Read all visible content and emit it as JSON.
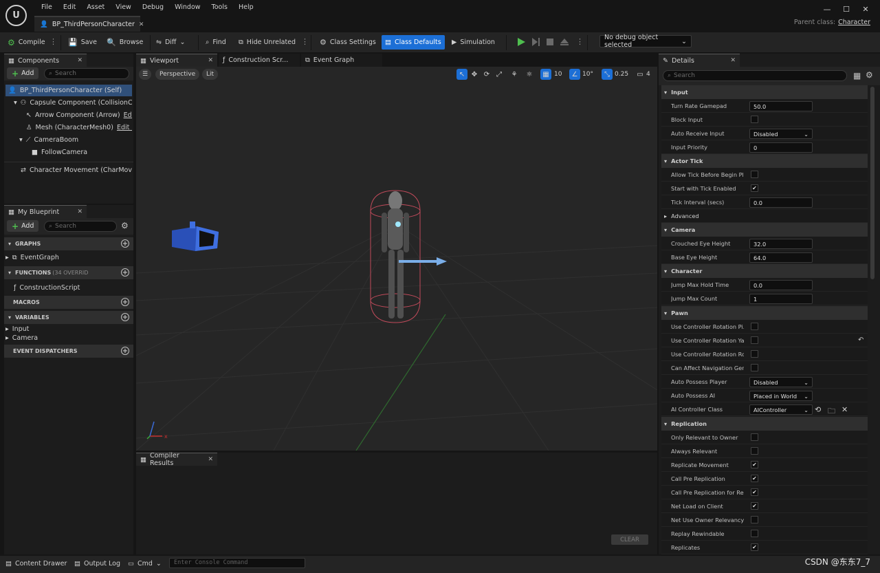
{
  "app": {
    "logo_text": "U"
  },
  "menu": [
    "File",
    "Edit",
    "Asset",
    "View",
    "Debug",
    "Window",
    "Tools",
    "Help"
  ],
  "document_tab": {
    "label": "BP_ThirdPersonCharacter"
  },
  "parent_class": {
    "label": "Parent class:",
    "value": "Character"
  },
  "toolbar": {
    "compile": "Compile",
    "save": "Save",
    "browse": "Browse",
    "diff": "Diff",
    "find": "Find",
    "hide_unrelated": "Hide Unrelated",
    "class_settings": "Class Settings",
    "class_defaults": "Class Defaults",
    "simulation": "Simulation",
    "debug_object": "No debug object selected"
  },
  "components": {
    "tab": "Components",
    "add": "Add",
    "search_placeholder": "Search",
    "items": [
      {
        "label": "BP_ThirdPersonCharacter (Self)",
        "link": ""
      },
      {
        "label": "Capsule Component (CollisionCylir",
        "link": ""
      },
      {
        "label": "Arrow Component (Arrow)",
        "link": "Edit i"
      },
      {
        "label": "Mesh (CharacterMesh0)",
        "link": "Edit in"
      },
      {
        "label": "CameraBoom",
        "link": ""
      },
      {
        "label": "FollowCamera",
        "link": ""
      },
      {
        "label": "Character Movement (CharMoveC",
        "link": ""
      }
    ]
  },
  "my_blueprint": {
    "tab": "My Blueprint",
    "add": "Add",
    "search_placeholder": "Search",
    "graphs": "GRAPHS",
    "event_graph": "EventGraph",
    "functions": "FUNCTIONS",
    "functions_note": "(34 OVERRID",
    "construction_script": "ConstructionScript",
    "macros": "MACROS",
    "variables": "VARIABLES",
    "var_input": "Input",
    "var_camera": "Camera",
    "event_dispatchers": "EVENT DISPATCHERS"
  },
  "editor_tabs": {
    "viewport": "Viewport",
    "construction": "Construction Scr...",
    "event_graph": "Event Graph"
  },
  "viewport": {
    "perspective": "Perspective",
    "lit": "Lit",
    "grid_snap": "10",
    "rot_snap": "10°",
    "scale_snap": "0.25",
    "cam_speed": "4",
    "axis_x": "x"
  },
  "compiler": {
    "tab": "Compiler Results",
    "clear": "CLEAR"
  },
  "details": {
    "tab": "Details",
    "search_placeholder": "Search",
    "sections": {
      "input": "Input",
      "actor_tick": "Actor Tick",
      "advanced": "Advanced",
      "camera": "Camera",
      "character": "Character",
      "pawn": "Pawn",
      "replication": "Replication"
    },
    "rows": {
      "turn_rate_label": "Turn Rate Gamepad",
      "turn_rate_value": "50.0",
      "block_input_label": "Block Input",
      "auto_receive_label": "Auto Receive Input",
      "auto_receive_value": "Disabled",
      "input_priority_label": "Input Priority",
      "input_priority_value": "0",
      "allow_tick_label": "Allow Tick Before Begin Pl...",
      "start_tick_label": "Start with Tick Enabled",
      "tick_interval_label": "Tick Interval (secs)",
      "tick_interval_value": "0.0",
      "crouched_eye_label": "Crouched Eye Height",
      "crouched_eye_value": "32.0",
      "base_eye_label": "Base Eye Height",
      "base_eye_value": "64.0",
      "jump_hold_label": "Jump Max Hold Time",
      "jump_hold_value": "0.0",
      "jump_count_label": "Jump Max Count",
      "jump_count_value": "1",
      "use_ctrl_pitch_label": "Use Controller Rotation Pi...",
      "use_ctrl_yaw_label": "Use Controller Rotation Yaw",
      "use_ctrl_roll_label": "Use Controller Rotation Roll",
      "can_affect_nav_label": "Can Affect Navigation Gen...",
      "auto_possess_player_label": "Auto Possess Player",
      "auto_possess_player_value": "Disabled",
      "auto_possess_ai_label": "Auto Possess AI",
      "auto_possess_ai_value": "Placed in World",
      "ai_controller_label": "AI Controller Class",
      "ai_controller_value": "AIController",
      "only_relevant_label": "Only Relevant to Owner",
      "always_relevant_label": "Always Relevant",
      "replicate_movement_label": "Replicate Movement",
      "call_pre_rep_label": "Call Pre Replication",
      "call_pre_rep_for_label": "Call Pre Replication for Re...",
      "net_load_label": "Net Load on Client",
      "net_use_owner_label": "Net Use Owner Relevancy",
      "replay_rewindable_label": "Replay Rewindable",
      "replicates_label": "Replicates"
    },
    "checks": {
      "block_input": false,
      "allow_tick": false,
      "start_tick": true,
      "use_ctrl_pitch": false,
      "use_ctrl_yaw": false,
      "use_ctrl_roll": false,
      "can_affect_nav": false,
      "only_relevant": false,
      "always_relevant": false,
      "replicate_movement": true,
      "call_pre_rep": true,
      "call_pre_rep_for": true,
      "net_load": true,
      "net_use_owner": false,
      "replay_rewindable": false,
      "replicates": true
    },
    "check_glyph": "✔"
  },
  "statusbar": {
    "content_drawer": "Content Drawer",
    "output_log": "Output Log",
    "cmd": "Cmd",
    "console_placeholder": "Enter Console Command",
    "watermark": "CSDN @东东7_7"
  },
  "colors": {
    "accent": "#1c6fd6",
    "play": "#4fbe4f",
    "check": "#d8d8d8"
  }
}
